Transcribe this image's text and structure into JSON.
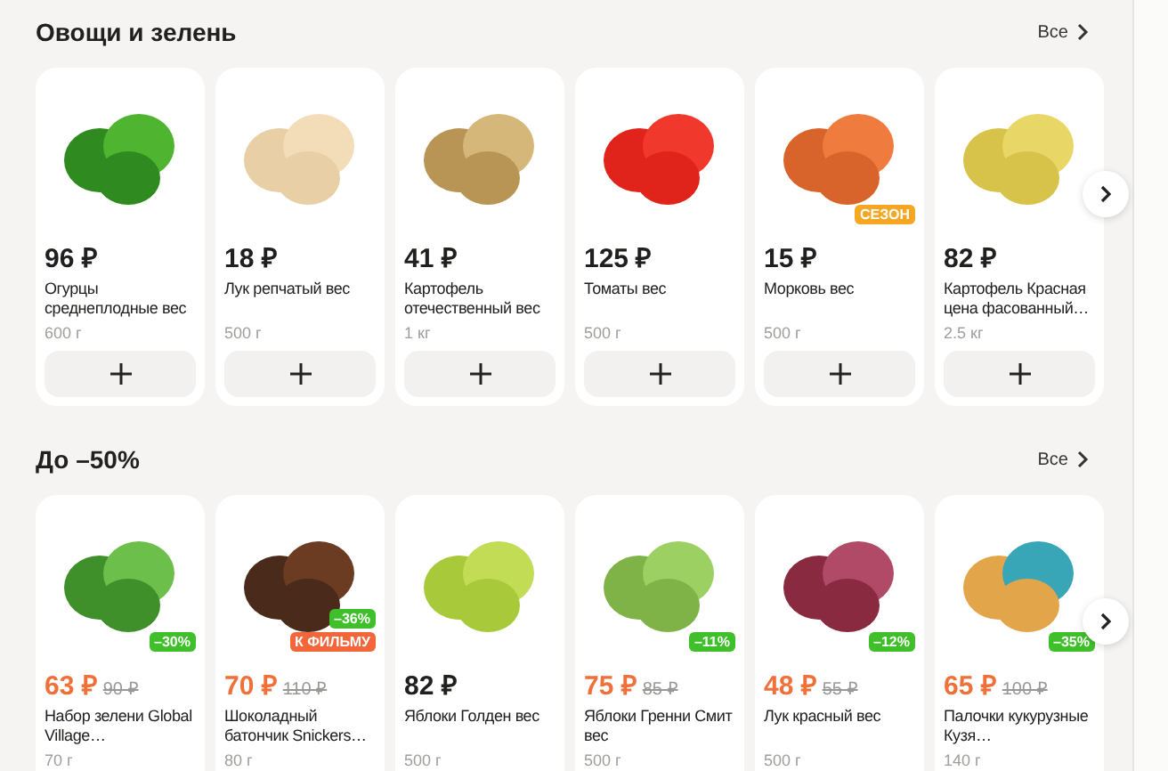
{
  "sections": [
    {
      "title": "Овощи и зелень",
      "all_link": "Все",
      "products": [
        {
          "price": "96 ₽",
          "name": "Огурцы среднеплодные вес",
          "weight": "600 г"
        },
        {
          "price": "18 ₽",
          "name": "Лук репчатый вес",
          "weight": "500 г"
        },
        {
          "price": "41 ₽",
          "name": "Картофель отечественный вес",
          "weight": "1 кг"
        },
        {
          "price": "125 ₽",
          "name": "Томаты вес",
          "weight": "500 г"
        },
        {
          "price": "15 ₽",
          "name": "Морковь вес",
          "weight": "500 г",
          "badges": [
            {
              "kind": "season",
              "text": "СЕЗОН"
            }
          ]
        },
        {
          "price": "82 ₽",
          "name": "Картофель Красная цена фасованный…",
          "weight": "2.5 кг"
        }
      ]
    },
    {
      "title": "До –50%",
      "all_link": "Все",
      "products": [
        {
          "price": "63 ₽",
          "old_price": "90 ₽",
          "name": "Набор зелени Global Village…",
          "weight": "70 г",
          "badges": [
            {
              "kind": "discount",
              "text": "–30%"
            }
          ]
        },
        {
          "price": "70 ₽",
          "old_price": "110 ₽",
          "name": "Шоколадный батончик Snickers…",
          "weight": "80 г",
          "badges": [
            {
              "kind": "discount",
              "text": "–36%"
            },
            {
              "kind": "promo",
              "text": "К ФИЛЬМУ"
            }
          ]
        },
        {
          "price": "82 ₽",
          "name": "Яблоки Голден вес",
          "weight": "500 г"
        },
        {
          "price": "75 ₽",
          "old_price": "85 ₽",
          "name": "Яблоки Гренни Смит вес",
          "weight": "500 г",
          "badges": [
            {
              "kind": "discount",
              "text": "–11%"
            }
          ]
        },
        {
          "price": "48 ₽",
          "old_price": "55 ₽",
          "name": "Лук красный вес",
          "weight": "500 г",
          "badges": [
            {
              "kind": "discount",
              "text": "–12%"
            }
          ]
        },
        {
          "price": "65 ₽",
          "old_price": "100 ₽",
          "name": "Палочки кукурузные Кузя…",
          "weight": "140 г",
          "badges": [
            {
              "kind": "discount",
              "text": "–35%"
            }
          ]
        }
      ]
    }
  ]
}
